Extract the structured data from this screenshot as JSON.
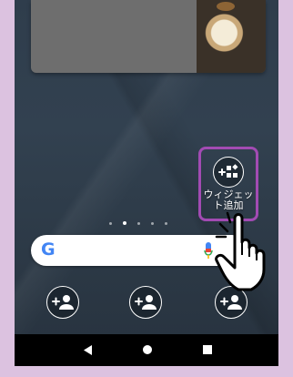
{
  "widget": {
    "label_line1": "ウィジェッ",
    "label_line2": "ト追加",
    "icon": "add-widget-icon"
  },
  "page_indicator": {
    "count": 5,
    "active_index": 2
  },
  "search": {
    "logo": "G",
    "mic_icon": "mic-icon"
  },
  "dock": {
    "icons": [
      "add-contact-icon",
      "add-contact-icon",
      "add-contact-icon"
    ]
  },
  "nav": {
    "back": "back-icon",
    "home": "home-icon",
    "recents": "recents-icon"
  },
  "colors": {
    "highlight": "#a24bb3",
    "background": "#dcc2e0",
    "google_blue": "#4285f4"
  }
}
